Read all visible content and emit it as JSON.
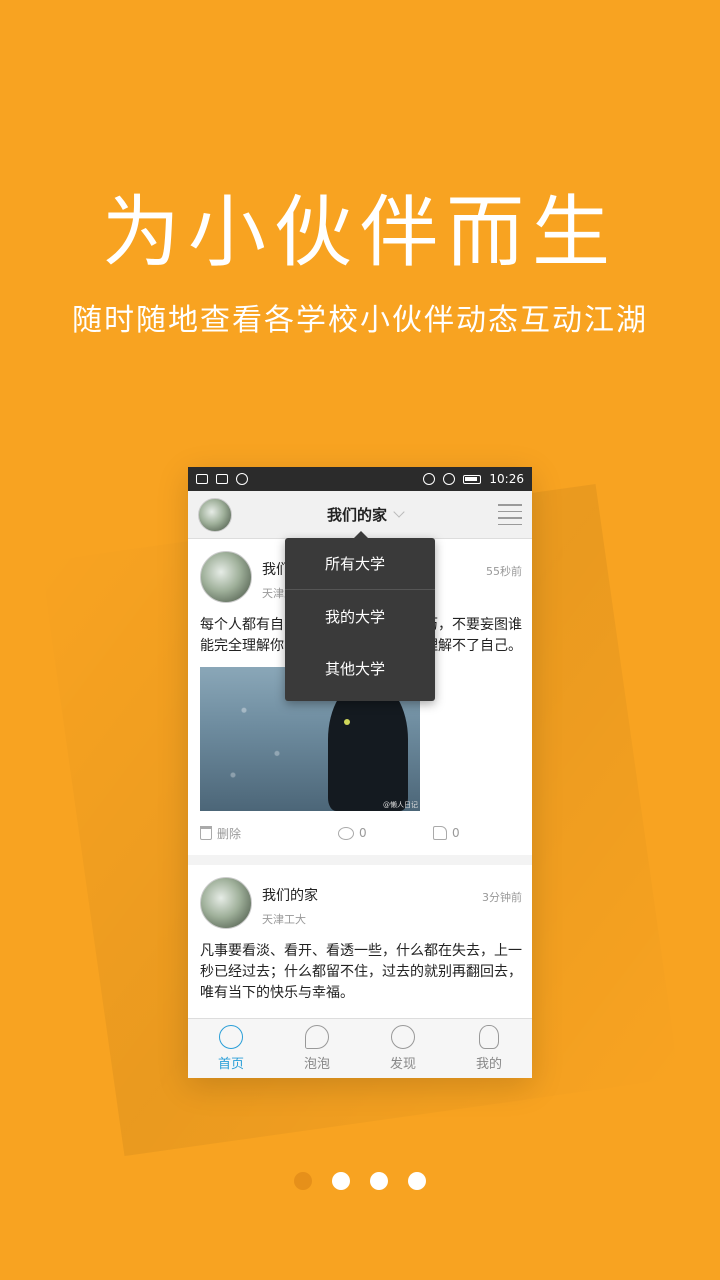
{
  "promo": {
    "headline": "为小伙伴而生",
    "subline": "随时随地查看各学校小伙伴动态互动江湖"
  },
  "statusbar": {
    "time": "10:26"
  },
  "appbar": {
    "title": "我们的家"
  },
  "dropdown": {
    "items": [
      "所有大学",
      "我的大学",
      "其他大学"
    ]
  },
  "posts": [
    {
      "user": "我们的家",
      "school": "天津工大",
      "time": "55秒前",
      "text": "每个人都有自己的一些不为人知的经历，不要妄图谁能完全理解你，大有的时候连自己都理解不了自己。",
      "image_caption": "@懒人日记",
      "delete_label": "删除",
      "comments": "0",
      "likes": "0"
    },
    {
      "user": "我们的家",
      "school": "天津工大",
      "time": "3分钟前",
      "text": "凡事要看淡、看开、看透一些，什么都在失去，上一秒已经过去；什么都留不住，过去的就别再翻回去，唯有当下的快乐与幸福。"
    }
  ],
  "tabs": [
    {
      "label": "首页",
      "icon": "home-wave-icon",
      "active": true
    },
    {
      "label": "泡泡",
      "icon": "bubble-icon",
      "active": false
    },
    {
      "label": "发现",
      "icon": "search-icon",
      "active": false
    },
    {
      "label": "我的",
      "icon": "user-icon",
      "active": false
    }
  ],
  "pager": {
    "total": 4,
    "current": 1
  },
  "colors": {
    "background": "#f8a321",
    "accent": "#2a9fd8",
    "dropdown": "#3a3a3a"
  }
}
